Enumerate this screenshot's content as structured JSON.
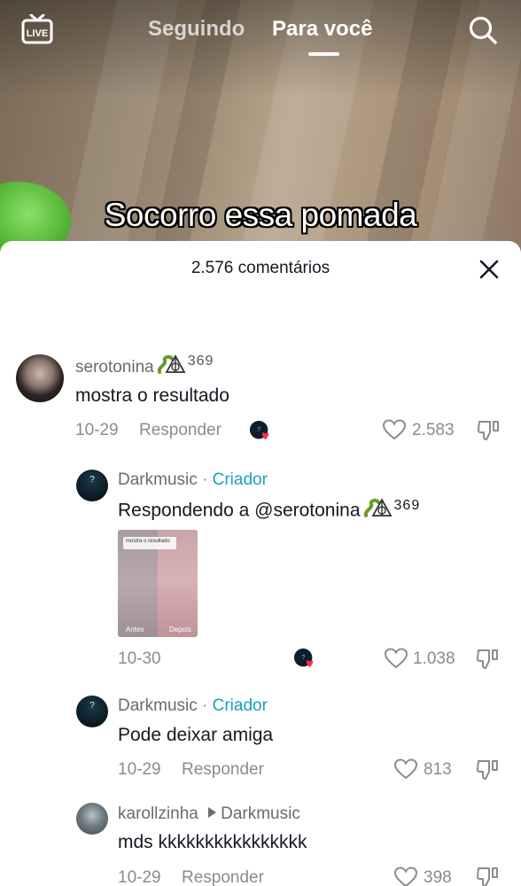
{
  "header": {
    "live_label": "LIVE",
    "tabs": [
      {
        "label": "Seguindo"
      },
      {
        "label": "Para você"
      }
    ],
    "search_icon": "search-icon"
  },
  "video": {
    "caption": "Socorro essa pomada"
  },
  "comments_panel": {
    "title": "2.576 comentários",
    "close_icon": "close-icon",
    "comments": [
      {
        "username": "serotonina",
        "username_suffix": "369",
        "text": "mostra o resultado",
        "date": "10-29",
        "reply_label": "Responder",
        "likes": "2.583"
      },
      {
        "username": "Darkmusic",
        "separator": " · ",
        "role": "Criador",
        "text": "Respondendo a @serotonina",
        "text_suffix": "369",
        "date": "10-30",
        "likes": "1.038",
        "image": {
          "note": "mostra o resultado",
          "left_label": "Antes",
          "right_label": "Depois"
        }
      },
      {
        "username": "Darkmusic",
        "separator": " · ",
        "role": "Criador",
        "text": "Pode deixar amiga",
        "date": "10-29",
        "reply_label": "Responder",
        "likes": "813"
      },
      {
        "username": "karollzinha",
        "reply_to": "Darkmusic",
        "text": "mds kkkkkkkkkkkkkkkk",
        "date": "10-29",
        "reply_label": "Responder",
        "likes": "398"
      }
    ]
  },
  "colors": {
    "creator": "#1a9ec2",
    "text": "#161823",
    "muted": "#8a8b91",
    "like_badge": "#fe2c55"
  }
}
